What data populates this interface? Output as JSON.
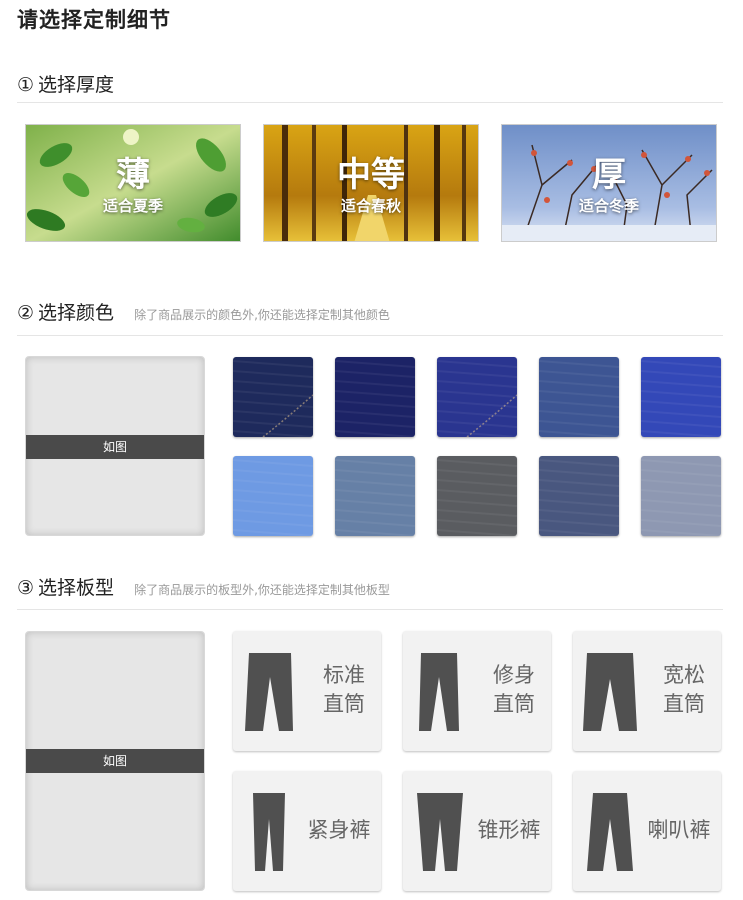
{
  "page": {
    "title": "请选择定制细节"
  },
  "thickness": {
    "num": "①",
    "label": "选择厚度",
    "options": [
      {
        "title": "薄",
        "subtitle": "适合夏季",
        "theme": "green-leaves"
      },
      {
        "title": "中等",
        "subtitle": "适合春秋",
        "theme": "golden-forest"
      },
      {
        "title": "厚",
        "subtitle": "适合冬季",
        "theme": "winter-branches"
      }
    ]
  },
  "color": {
    "num": "②",
    "label": "选择颜色",
    "hint": "除了商品展示的颜色外,你还能选择定制其他颜色",
    "preview_label": "如图",
    "swatches": [
      {
        "name": "dark-denim-stitched",
        "color": "#1e2a5c"
      },
      {
        "name": "navy-denim",
        "color": "#1c2366"
      },
      {
        "name": "indigo-denim-stitched",
        "color": "#2a3590"
      },
      {
        "name": "mid-blue-denim",
        "color": "#3d5593"
      },
      {
        "name": "royal-blue",
        "color": "#3348b8"
      },
      {
        "name": "light-blue",
        "color": "#6e9ae3"
      },
      {
        "name": "grey-blue",
        "color": "#6680a6"
      },
      {
        "name": "charcoal",
        "color": "#5a5c60"
      },
      {
        "name": "washed-denim",
        "color": "#49577f"
      },
      {
        "name": "light-grey-blue",
        "color": "#8e98b2"
      }
    ]
  },
  "fit": {
    "num": "③",
    "label": "选择板型",
    "hint": "除了商品展示的板型外,你还能选择定制其他板型",
    "preview_label": "如图",
    "options": [
      {
        "line1": "标准",
        "line2": "直筒",
        "icon": "straight-pants-icon"
      },
      {
        "line1": "修身",
        "line2": "直筒",
        "icon": "slim-pants-icon"
      },
      {
        "line1": "宽松",
        "line2": "直筒",
        "icon": "loose-pants-icon"
      },
      {
        "line1": "紧身裤",
        "line2": "",
        "icon": "skinny-pants-icon"
      },
      {
        "line1": "锥形裤",
        "line2": "",
        "icon": "tapered-pants-icon"
      },
      {
        "line1": "喇叭裤",
        "line2": "",
        "icon": "flare-pants-icon"
      }
    ]
  }
}
